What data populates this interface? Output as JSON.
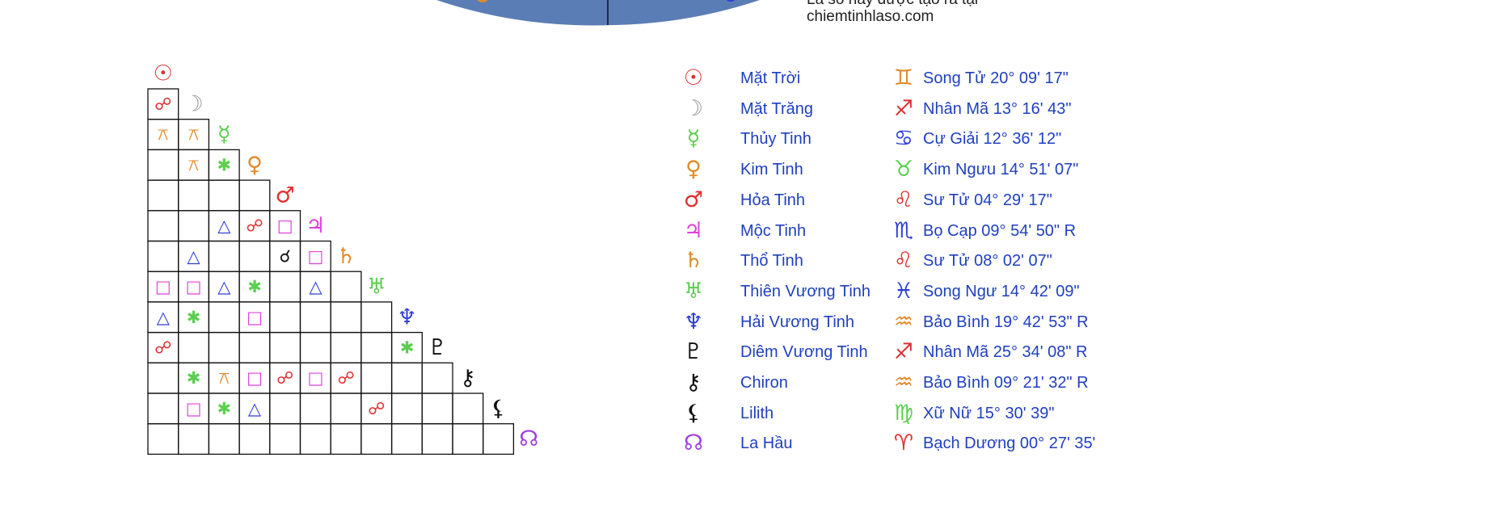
{
  "credit": {
    "line1": "Lá số này được tạo ra tại",
    "line2": "chiemtinhlaso.com"
  },
  "colors": {
    "wheel": "#5b7db5",
    "grid_line": "#111111",
    "legend_text": "#1f3fbf"
  },
  "icon_legend": {
    "sun": "sun-icon",
    "moon": "moon-icon",
    "mercury": "mercury-icon",
    "venus": "venus-icon",
    "mars": "mars-icon",
    "jupiter": "jupiter-icon",
    "saturn": "saturn-icon",
    "uranus": "uranus-icon",
    "neptune": "neptune-icon",
    "pluto": "pluto-icon",
    "chiron": "chiron-icon",
    "lilith": "lilith-icon",
    "node": "north-node-icon"
  },
  "bodies": [
    {
      "key": "sun",
      "glyph": "☉",
      "color": "#e03030",
      "name": "Mặt Trời",
      "sign_glyph": "♊",
      "sign_color": "#e08a2c",
      "position": "Song Tử 20° 09' 17\""
    },
    {
      "key": "moon",
      "glyph": "☽",
      "color": "#9a9a9a",
      "name": "Mặt Trăng",
      "sign_glyph": "♐",
      "sign_color": "#e03030",
      "position": "Nhân Mã 13° 16' 43\""
    },
    {
      "key": "mercury",
      "glyph": "☿",
      "color": "#5ccf4f",
      "name": "Thủy Tinh",
      "sign_glyph": "♋",
      "sign_color": "#2f3fd8",
      "position": "Cự Giải 12° 36' 12\""
    },
    {
      "key": "venus",
      "glyph": "♀",
      "color": "#e08a2c",
      "name": "Kim Tinh",
      "sign_glyph": "♉",
      "sign_color": "#5ccf4f",
      "position": "Kim Ngưu 14° 51' 07\""
    },
    {
      "key": "mars",
      "glyph": "♂",
      "color": "#e03030",
      "name": "Hỏa Tinh",
      "sign_glyph": "♌",
      "sign_color": "#e03030",
      "position": "Sư Tử 04° 29' 17\""
    },
    {
      "key": "jupiter",
      "glyph": "♃",
      "color": "#e040e0",
      "name": "Mộc Tinh",
      "sign_glyph": "♏",
      "sign_color": "#2f3fd8",
      "position": "Bọ Cạp 09° 54' 50\" R"
    },
    {
      "key": "saturn",
      "glyph": "♄",
      "color": "#e08a2c",
      "name": "Thổ Tinh",
      "sign_glyph": "♌",
      "sign_color": "#e03030",
      "position": "Sư Tử 08° 02' 07\""
    },
    {
      "key": "uranus",
      "glyph": "♅",
      "color": "#5ccf4f",
      "name": "Thiên Vương Tinh",
      "sign_glyph": "♓",
      "sign_color": "#2f3fd8",
      "position": "Song Ngư 14° 42' 09\""
    },
    {
      "key": "neptune",
      "glyph": "♆",
      "color": "#2f3fd8",
      "name": "Hải Vương Tinh",
      "sign_glyph": "♒",
      "sign_color": "#e08a2c",
      "position": "Bảo Bình 19° 42' 53\" R"
    },
    {
      "key": "pluto",
      "glyph": "♇",
      "color": "#111111",
      "name": "Diêm Vương Tinh",
      "sign_glyph": "♐",
      "sign_color": "#e03030",
      "position": "Nhân Mã 25° 34' 08\" R"
    },
    {
      "key": "chiron",
      "glyph": "⚷",
      "color": "#111111",
      "name": "Chiron",
      "sign_glyph": "♒",
      "sign_color": "#e08a2c",
      "position": "Bảo Bình 09° 21' 32\" R"
    },
    {
      "key": "lilith",
      "glyph": "⚸",
      "color": "#111111",
      "name": "Lilith",
      "sign_glyph": "♍",
      "sign_color": "#5ccf4f",
      "position": "Xữ Nữ 15° 30' 39\""
    },
    {
      "key": "node",
      "glyph": "☊",
      "color": "#a040e0",
      "name": "La Hầu",
      "sign_glyph": "♈",
      "sign_color": "#e03030",
      "position": "Bạch Dương 00° 27' 35'"
    }
  ],
  "aspect_styles": {
    "opposition": {
      "glyph": "☍",
      "color": "#e03030",
      "icon": "opposition-icon"
    },
    "quincunx": {
      "glyph": "⚻",
      "color": "#e08a2c",
      "icon": "quincunx-icon"
    },
    "sextile": {
      "glyph": "✱",
      "color": "#5ccf4f",
      "icon": "sextile-icon"
    },
    "trine": {
      "glyph": "△",
      "color": "#2f3fd8",
      "icon": "trine-icon"
    },
    "square": {
      "glyph": "□",
      "color": "#e040e0",
      "icon": "square-icon"
    },
    "conjunction": {
      "glyph": "☌",
      "color": "#111111",
      "icon": "conjunction-icon"
    }
  },
  "aspects": [
    [
      "opposition"
    ],
    [
      "quincunx",
      "quincunx"
    ],
    [
      "",
      "quincunx",
      "sextile"
    ],
    [
      "",
      "",
      "",
      ""
    ],
    [
      "",
      "",
      "trine",
      "opposition",
      "square"
    ],
    [
      "",
      "trine",
      "",
      "",
      "conjunction",
      "square"
    ],
    [
      "square",
      "square",
      "trine",
      "sextile",
      "",
      "trine",
      ""
    ],
    [
      "trine",
      "sextile",
      "",
      "square",
      "",
      "",
      "",
      ""
    ],
    [
      "opposition",
      "",
      "",
      "",
      "",
      "",
      "",
      "",
      "sextile"
    ],
    [
      "",
      "sextile",
      "quincunx",
      "square",
      "opposition",
      "square",
      "opposition",
      "",
      "",
      ""
    ],
    [
      "",
      "square",
      "sextile",
      "trine",
      "",
      "",
      "",
      "opposition",
      "",
      "",
      ""
    ],
    [
      "",
      "",
      "",
      "",
      "",
      "",
      "",
      "",
      "",
      "",
      "",
      ""
    ]
  ]
}
